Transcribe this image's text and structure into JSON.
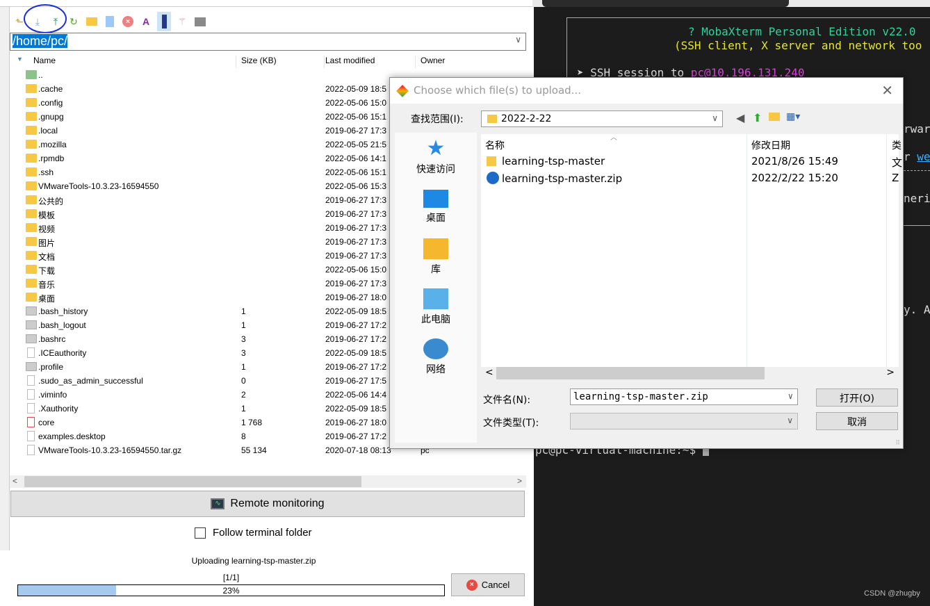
{
  "toolbar": {
    "icons": [
      "parent-folder-icon",
      "download-icon",
      "upload-icon",
      "refresh-icon",
      "new-folder-icon",
      "new-file-icon",
      "delete-icon",
      "rename-icon",
      "toggle-hidden-icon",
      "magic-wand-icon",
      "terminal-icon"
    ]
  },
  "path": "/home/pc/",
  "columns": {
    "name": "Name",
    "size": "Size (KB)",
    "modified": "Last modified",
    "owner": "Owner"
  },
  "files": [
    {
      "name": "..",
      "size": "",
      "date": "",
      "owner": "",
      "type": "parent"
    },
    {
      "name": ".cache",
      "size": "",
      "date": "2022-05-09 18:5",
      "type": "folder"
    },
    {
      "name": ".config",
      "size": "",
      "date": "2022-05-06 15:0",
      "type": "folder"
    },
    {
      "name": ".gnupg",
      "size": "",
      "date": "2022-05-06 15:1",
      "type": "folder"
    },
    {
      "name": ".local",
      "size": "",
      "date": "2019-06-27 17:3",
      "type": "folder"
    },
    {
      "name": ".mozilla",
      "size": "",
      "date": "2022-05-05 21:5",
      "type": "folder"
    },
    {
      "name": ".rpmdb",
      "size": "",
      "date": "2022-05-06 14:1",
      "type": "folder"
    },
    {
      "name": ".ssh",
      "size": "",
      "date": "2022-05-06 15:1",
      "type": "folder"
    },
    {
      "name": "VMwareTools-10.3.23-16594550",
      "size": "",
      "date": "2022-05-06 15:3",
      "type": "folder"
    },
    {
      "name": "公共的",
      "size": "",
      "date": "2019-06-27 17:3",
      "type": "folder"
    },
    {
      "name": "模板",
      "size": "",
      "date": "2019-06-27 17:3",
      "type": "folder"
    },
    {
      "name": "视频",
      "size": "",
      "date": "2019-06-27 17:3",
      "type": "folder"
    },
    {
      "name": "图片",
      "size": "",
      "date": "2019-06-27 17:3",
      "type": "folder"
    },
    {
      "name": "文档",
      "size": "",
      "date": "2019-06-27 17:3",
      "type": "folder"
    },
    {
      "name": "下载",
      "size": "",
      "date": "2022-05-06 15:0",
      "type": "folder"
    },
    {
      "name": "音乐",
      "size": "",
      "date": "2019-06-27 17:3",
      "type": "folder"
    },
    {
      "name": "桌面",
      "size": "",
      "date": "2019-06-27 18:0",
      "type": "folder"
    },
    {
      "name": ".bash_history",
      "size": "1",
      "date": "2022-05-09 18:5",
      "type": "grey"
    },
    {
      "name": ".bash_logout",
      "size": "1",
      "date": "2019-06-27 17:2",
      "type": "grey"
    },
    {
      "name": ".bashrc",
      "size": "3",
      "date": "2019-06-27 17:2",
      "type": "grey"
    },
    {
      "name": ".ICEauthority",
      "size": "3",
      "date": "2022-05-09 18:5",
      "type": "file"
    },
    {
      "name": ".profile",
      "size": "1",
      "date": "2019-06-27 17:2",
      "type": "grey"
    },
    {
      "name": ".sudo_as_admin_successful",
      "size": "0",
      "date": "2019-06-27 17:5",
      "type": "file"
    },
    {
      "name": ".viminfo",
      "size": "2",
      "date": "2022-05-06 14:4",
      "type": "file"
    },
    {
      "name": ".Xauthority",
      "size": "1",
      "date": "2022-05-09 18:5",
      "type": "file"
    },
    {
      "name": "core",
      "size": "1 768",
      "date": "2019-06-27 18:0",
      "type": "core"
    },
    {
      "name": "examples.desktop",
      "size": "8",
      "date": "2019-06-27 17:2",
      "type": "file"
    },
    {
      "name": "VMwareTools-10.3.23-16594550.tar.gz",
      "size": "55 134",
      "date": "2020-07-18 08:13",
      "owner": "pc",
      "type": "archive"
    }
  ],
  "remote_monitoring": "Remote monitoring",
  "follow_terminal": {
    "label": "Follow terminal folder",
    "checked": false
  },
  "upload": {
    "status": "Uploading learning-tsp-master.zip",
    "count": "[1/1]",
    "percent": 23,
    "percent_label": "23%",
    "cancel": "Cancel"
  },
  "terminal": {
    "banner1": "? MobaXterm Personal Edition v22.0",
    "banner2": "(SSH client, X server and network too",
    "session_prefix": "➤ SSH session to ",
    "session_host": "pc@10.196.131.240",
    "frag1": "rwar",
    "frag2a": "r ",
    "frag2b": "we",
    "frag3": "neri",
    "frag4": "y. A",
    "prompt": "pc@pc-virtual-machine:~$"
  },
  "watermark": "CSDN @zhugby",
  "dialog": {
    "title": "Choose which file(s) to upload...",
    "look_in_label": "查找范围(I):",
    "look_in_value": "2022-2-22",
    "places": [
      "快速访问",
      "桌面",
      "库",
      "此电脑",
      "网络"
    ],
    "col_name": "名称",
    "col_date": "修改日期",
    "col_type": "类",
    "files": [
      {
        "name": "learning-tsp-master",
        "date": "2021/8/26 15:49",
        "type": "文"
      },
      {
        "name": "learning-tsp-master.zip",
        "date": "2022/2/22 15:20",
        "type": "Z"
      }
    ],
    "filename_label": "文件名(N):",
    "filename_value": "learning-tsp-master.zip",
    "filetype_label": "文件类型(T):",
    "open": "打开(O)",
    "cancel": "取消"
  }
}
